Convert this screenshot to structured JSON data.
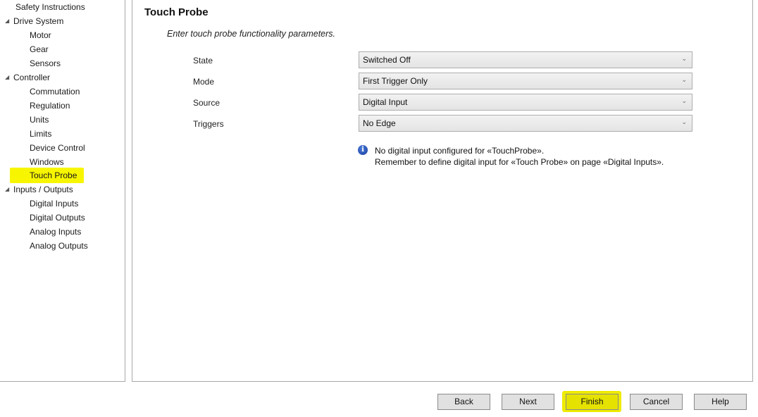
{
  "sidebar": {
    "items": [
      {
        "label": "Safety Instructions",
        "level": 1,
        "expandable": false
      },
      {
        "label": "Drive System",
        "level": 0,
        "expandable": true
      },
      {
        "label": "Motor",
        "level": 1
      },
      {
        "label": "Gear",
        "level": 1
      },
      {
        "label": "Sensors",
        "level": 1
      },
      {
        "label": "Controller",
        "level": 0,
        "expandable": true
      },
      {
        "label": "Commutation",
        "level": 1
      },
      {
        "label": "Regulation",
        "level": 1
      },
      {
        "label": "Units",
        "level": 1
      },
      {
        "label": "Limits",
        "level": 1
      },
      {
        "label": "Device Control",
        "level": 1
      },
      {
        "label": "Windows",
        "level": 1
      },
      {
        "label": "Touch Probe",
        "level": 1,
        "selected": true
      },
      {
        "label": "Inputs / Outputs",
        "level": 0,
        "expandable": true
      },
      {
        "label": "Digital Inputs",
        "level": 1
      },
      {
        "label": "Digital Outputs",
        "level": 1
      },
      {
        "label": "Analog Inputs",
        "level": 1
      },
      {
        "label": "Analog Outputs",
        "level": 1
      }
    ],
    "expand_glyph": "◢",
    "highlight_color": "#f7f500"
  },
  "main": {
    "title": "Touch Probe",
    "subtitle": "Enter touch probe functionality parameters.",
    "fields": [
      {
        "label": "State",
        "value": "Switched Off"
      },
      {
        "label": "Mode",
        "value": "First Trigger Only"
      },
      {
        "label": "Source",
        "value": "Digital Input"
      },
      {
        "label": "Triggers",
        "value": "No Edge"
      }
    ],
    "dropdown_glyph": "⌄",
    "info": {
      "icon": "info-icon",
      "line1": "No digital input configured for «TouchProbe».",
      "line2": "Remember to define digital input for «Touch Probe» on page «Digital Inputs»."
    }
  },
  "footer": {
    "buttons": {
      "back": "Back",
      "next": "Next",
      "finish": "Finish",
      "cancel": "Cancel",
      "help": "Help"
    }
  }
}
